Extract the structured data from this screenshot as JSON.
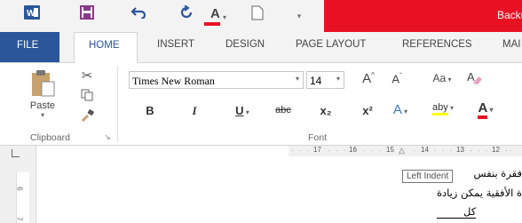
{
  "title_bar": {
    "title_visible": "Backu",
    "accent_color": "#e81123"
  },
  "quick_access": [
    {
      "name": "word-app-icon",
      "glyph": "W"
    },
    {
      "name": "save-icon",
      "glyph": "💾"
    },
    {
      "name": "undo-icon",
      "glyph": "↶"
    },
    {
      "name": "redo-icon",
      "glyph": "↻"
    },
    {
      "name": "font-color-icon",
      "glyph": "A"
    },
    {
      "name": "new-document-icon",
      "glyph": "🗋"
    },
    {
      "name": "customize-icon",
      "glyph": "⏷"
    }
  ],
  "tabs": {
    "file": "FILE",
    "home": "HOME",
    "insert": "INSERT",
    "design": "DESIGN",
    "page_layout": "PAGE LAYOUT",
    "references": "REFERENCES",
    "mailings": "MAI"
  },
  "clipboard": {
    "paste_label": "Paste",
    "group_label": "Clipboard",
    "launcher_glyph": "↘"
  },
  "font": {
    "font_name": "Times New Roman",
    "font_size": "14",
    "group_label": "Font",
    "bold": "B",
    "italic": "I",
    "underline": "U",
    "strikethrough": "abc",
    "subscript": "x₂",
    "superscript": "x²",
    "grow_font": "A",
    "shrink_font": "A",
    "change_case": "Aa",
    "text_effects": "A",
    "highlight": "aby",
    "font_color": "A"
  },
  "ruler": {
    "numbers": [
      "17",
      "16",
      "15",
      "14",
      "13",
      "12"
    ],
    "vertical_numbers": [
      "6",
      "7"
    ]
  },
  "tooltip": "Left Indent",
  "document": {
    "line1": "فقرة بنفس",
    "line2": "ة الأفقية يمكن زيادة",
    "line3": "كل"
  },
  "colors": {
    "brand": "#2b579a",
    "red": "#e81123"
  }
}
